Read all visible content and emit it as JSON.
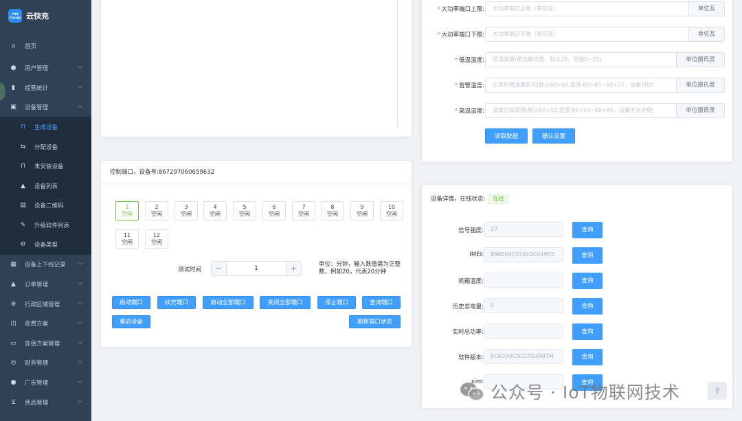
{
  "sidebar": {
    "logo_badge": "YUN Charge",
    "app_name": "云快充",
    "items": [
      {
        "label": "首页",
        "icon": "home-icon"
      },
      {
        "label": "用户管理",
        "icon": "user-icon"
      },
      {
        "label": "经营统计",
        "icon": "bar-chart-icon"
      },
      {
        "label": "设备管理",
        "icon": "device-icon"
      },
      {
        "label": "设备上下线记录",
        "icon": "calendar-icon"
      },
      {
        "label": "订单管理",
        "icon": "lock-icon"
      },
      {
        "label": "行政区域管理",
        "icon": "plus-circle-icon"
      },
      {
        "label": "收费方案",
        "icon": "book-icon"
      },
      {
        "label": "充值方案管理",
        "icon": "wallet-icon"
      },
      {
        "label": "财务管理",
        "icon": "database-icon"
      },
      {
        "label": "广告管理",
        "icon": "pin-icon"
      },
      {
        "label": "商品管理",
        "icon": "cart-icon"
      }
    ],
    "sub_items": [
      {
        "label": "生成设备",
        "icon": "bag-icon"
      },
      {
        "label": "分配设备",
        "icon": "share-icon"
      },
      {
        "label": "未安装设备",
        "icon": "bag-icon"
      },
      {
        "label": "设备列表",
        "icon": "lock-icon"
      },
      {
        "label": "设备二维码",
        "icon": "document-icon"
      },
      {
        "label": "升级软件列表",
        "icon": "edit-icon"
      },
      {
        "label": "设备类型",
        "icon": "gear-icon"
      }
    ]
  },
  "control": {
    "header": "控制端口，设备号:867297060659632",
    "ports": [
      {
        "num": "1",
        "status": "空闲"
      },
      {
        "num": "2",
        "status": "空闲"
      },
      {
        "num": "3",
        "status": "空闲"
      },
      {
        "num": "4",
        "status": "空闲"
      },
      {
        "num": "5",
        "status": "空闲"
      },
      {
        "num": "6",
        "status": "空闲"
      },
      {
        "num": "7",
        "status": "空闲"
      },
      {
        "num": "8",
        "status": "空闲"
      },
      {
        "num": "9",
        "status": "空闲"
      },
      {
        "num": "10",
        "status": "空闲"
      },
      {
        "num": "11",
        "status": "空闲"
      },
      {
        "num": "12",
        "status": "空闲"
      }
    ],
    "test_time_label": "测试时间",
    "stepper_minus": "−",
    "stepper_value": "1",
    "stepper_plus": "+",
    "hint": "单位：分钟，输入数值需为正整数，例如20，代表20分钟",
    "buttons": {
      "start_port": "启动端口",
      "recharge_port": "续充端口",
      "start_all": "启动全部端口",
      "close_all": "关闭全部端口",
      "stop_port": "停止端口",
      "query_port": "查询端口",
      "restart": "重启设备",
      "refresh_status": "刷新端口状态"
    }
  },
  "settings": {
    "rows": [
      {
        "label": "大功率端口上限:",
        "required": "*",
        "placeholder": "大功率端口上限（单位瓦）",
        "unit": "单位瓦"
      },
      {
        "label": "大功率端口下限:",
        "required": "*",
        "placeholder": "大功率端口下限（单位瓦）",
        "unit": "单位瓦"
      },
      {
        "label": "低温温度:",
        "required": "*",
        "placeholder": "低温禁用(单位摄氏度，默认20，范围0~25)",
        "unit": "单位摄氏度"
      },
      {
        "label": "告警温度:",
        "required": "*",
        "placeholder": "正常可用温度区间(默认60+60,范围 60+45~60+52，设备可以(",
        "unit": "单位摄氏度"
      },
      {
        "label": "高温温度:",
        "required": "*",
        "placeholder": "温度过高禁用(默认60+55,范围 60+53~60+60，设备不允许使(",
        "unit": "单位摄氏度"
      }
    ],
    "read_btn": "读取数据",
    "confirm_btn": "确认设置"
  },
  "details": {
    "header": "设备详情，在线状态:",
    "status": "在线",
    "query_label": "查询",
    "rows": [
      {
        "label": "信号强度:",
        "value": "27"
      },
      {
        "label": "IMEI:",
        "value": "898604C01922C04955"
      },
      {
        "label": "机箱温度:",
        "value": ""
      },
      {
        "label": "历史总电量:",
        "value": "0"
      },
      {
        "label": "实时总功率:",
        "value": ""
      },
      {
        "label": "软件版本:",
        "value": "EC600UCNLCR03A01M"
      },
      {
        "label": "sim:",
        "value": ""
      }
    ]
  },
  "watermark": "公众号 · IoT物联网技术",
  "scroll_top_icon": "arrow-up-icon"
}
